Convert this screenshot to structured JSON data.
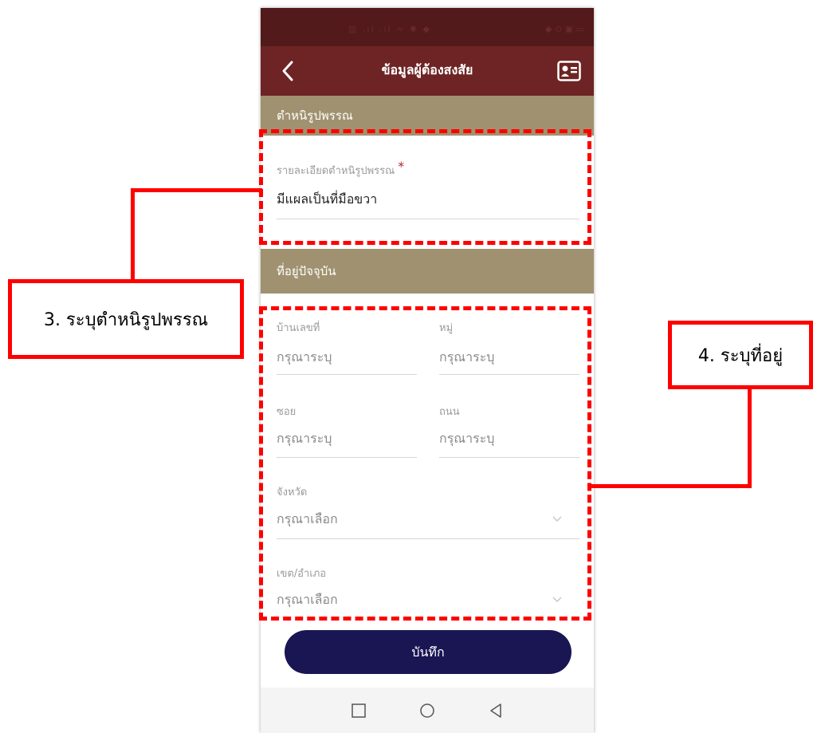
{
  "app": {
    "title": "ข้อมูลผู้ต้องสงสัย"
  },
  "status_bar": {
    "left": "▥  .ıl .ıl ≈ ✺ ◆",
    "right": "◆ ⊙ ▣ ▭"
  },
  "sections": {
    "marks": "ตำหนิรูปพรรณ",
    "address": "ที่อยู่ปัจจุบัน"
  },
  "marks": {
    "label": "รายละเอียดตำหนิรูปพรรณ",
    "required_mark": "*",
    "value": "มีแผลเป็นที่มือขวา"
  },
  "address": {
    "house_no": {
      "label": "บ้านเลขที่",
      "placeholder": "กรุณาระบุ"
    },
    "moo": {
      "label": "หมู่",
      "placeholder": "กรุณาระบุ"
    },
    "soi": {
      "label": "ซอย",
      "placeholder": "กรุณาระบุ"
    },
    "road": {
      "label": "ถนน",
      "placeholder": "กรุณาระบุ"
    },
    "province": {
      "label": "จังหวัด",
      "placeholder": "กรุณาเลือก"
    },
    "district": {
      "label": "เขต/อำเภอ",
      "placeholder": "กรุณาเลือก"
    }
  },
  "actions": {
    "save_label": "บันทึก"
  },
  "annotations": {
    "step3": "3. ระบุตำหนิรูปพรรณ",
    "step4": "4. ระบุที่อยู่",
    "color": "#ff0000"
  },
  "theme": {
    "status_bar": "#521a1a",
    "app_bar": "#6e2424",
    "section_header": "#a09270",
    "save_button": "#191653"
  },
  "icons": {
    "back": "chevron-left-icon",
    "id_card": "id-card-icon",
    "dropdown": "chevron-down-icon",
    "nav_recent": "square-icon",
    "nav_home": "circle-icon",
    "nav_back": "triangle-left-icon"
  }
}
